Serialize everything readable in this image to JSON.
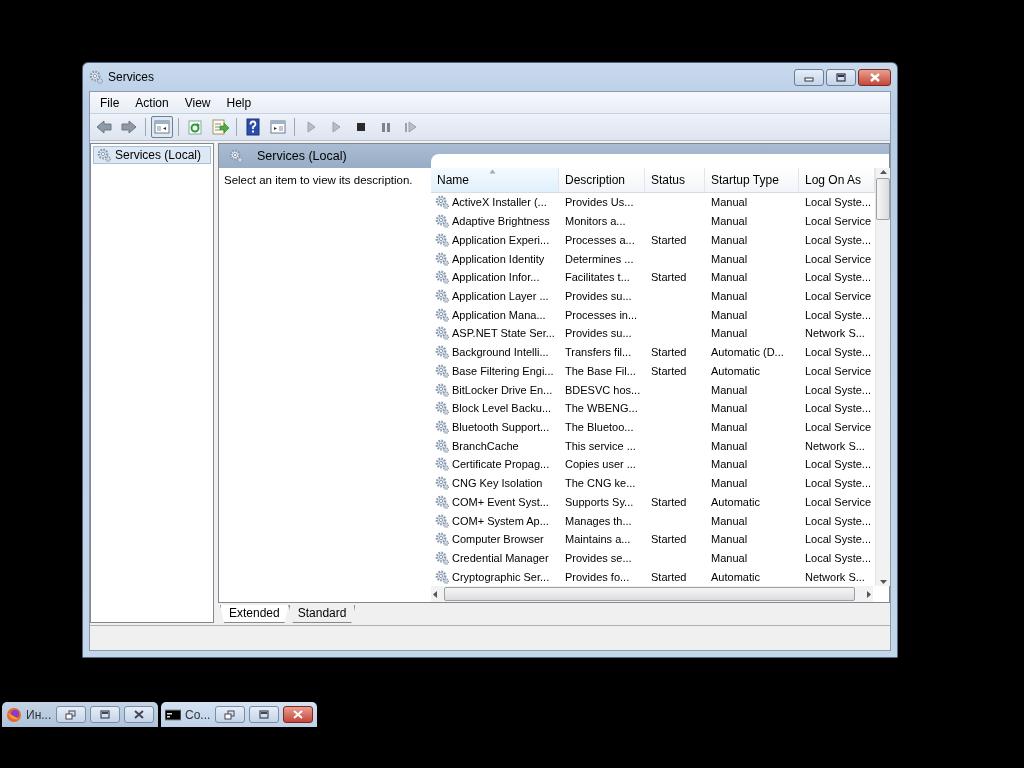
{
  "window": {
    "title": "Services"
  },
  "menu": [
    "File",
    "Action",
    "View",
    "Help"
  ],
  "toolbar": [
    {
      "kind": "back",
      "pressed": false
    },
    {
      "kind": "forward",
      "pressed": false
    },
    {
      "kind": "sep"
    },
    {
      "kind": "tree",
      "pressed": true
    },
    {
      "kind": "sep"
    },
    {
      "kind": "refresh",
      "pressed": false
    },
    {
      "kind": "export",
      "pressed": false
    },
    {
      "kind": "sep"
    },
    {
      "kind": "help",
      "pressed": false
    },
    {
      "kind": "panel",
      "pressed": false
    },
    {
      "kind": "sep"
    },
    {
      "kind": "start",
      "pressed": false
    },
    {
      "kind": "start",
      "pressed": false
    },
    {
      "kind": "stop",
      "pressed": false
    },
    {
      "kind": "pause",
      "pressed": false
    },
    {
      "kind": "resume",
      "pressed": false
    }
  ],
  "tree": [
    {
      "label": "Services (Local)",
      "selected": true
    }
  ],
  "pane": {
    "title": "Services (Local)",
    "description": "Select an item to view its description."
  },
  "table": {
    "columns": [
      {
        "label": "Name",
        "sorted": true
      },
      {
        "label": "Description",
        "sorted": false
      },
      {
        "label": "Status",
        "sorted": false
      },
      {
        "label": "Startup Type",
        "sorted": false
      },
      {
        "label": "Log On As",
        "sorted": false
      }
    ],
    "rows": [
      {
        "name": "ActiveX Installer (...",
        "description": "Provides Us...",
        "startup_type": "Manual",
        "log_on_as": "Local Syste..."
      },
      {
        "name": "Adaptive Brightness",
        "description": "Monitors a...",
        "startup_type": "Manual",
        "log_on_as": "Local Service"
      },
      {
        "name": "Application Experi...",
        "description": "Processes a...",
        "status": "Started",
        "startup_type": "Manual",
        "log_on_as": "Local Syste..."
      },
      {
        "name": "Application Identity",
        "description": "Determines ...",
        "startup_type": "Manual",
        "log_on_as": "Local Service"
      },
      {
        "name": "Application Infor...",
        "description": "Facilitates t...",
        "status": "Started",
        "startup_type": "Manual",
        "log_on_as": "Local Syste..."
      },
      {
        "name": "Application Layer ...",
        "description": "Provides su...",
        "startup_type": "Manual",
        "log_on_as": "Local Service"
      },
      {
        "name": "Application Mana...",
        "description": "Processes in...",
        "startup_type": "Manual",
        "log_on_as": "Local Syste..."
      },
      {
        "name": "ASP.NET State Ser...",
        "description": "Provides su...",
        "startup_type": "Manual",
        "log_on_as": "Network S..."
      },
      {
        "name": "Background Intelli...",
        "description": "Transfers fil...",
        "status": "Started",
        "startup_type": "Automatic (D...",
        "log_on_as": "Local Syste..."
      },
      {
        "name": "Base Filtering Engi...",
        "description": "The Base Fil...",
        "status": "Started",
        "startup_type": "Automatic",
        "log_on_as": "Local Service"
      },
      {
        "name": "BitLocker Drive En...",
        "description": "BDESVC hos...",
        "startup_type": "Manual",
        "log_on_as": "Local Syste..."
      },
      {
        "name": "Block Level Backu...",
        "description": "The WBENG...",
        "startup_type": "Manual",
        "log_on_as": "Local Syste..."
      },
      {
        "name": "Bluetooth Support...",
        "description": "The Bluetoo...",
        "startup_type": "Manual",
        "log_on_as": "Local Service"
      },
      {
        "name": "BranchCache",
        "description": "This service ...",
        "startup_type": "Manual",
        "log_on_as": "Network S..."
      },
      {
        "name": "Certificate Propag...",
        "description": "Copies user ...",
        "startup_type": "Manual",
        "log_on_as": "Local Syste..."
      },
      {
        "name": "CNG Key Isolation",
        "description": "The CNG ke...",
        "startup_type": "Manual",
        "log_on_as": "Local Syste..."
      },
      {
        "name": "COM+ Event Syst...",
        "description": "Supports Sy...",
        "status": "Started",
        "startup_type": "Automatic",
        "log_on_as": "Local Service"
      },
      {
        "name": "COM+ System Ap...",
        "description": "Manages th...",
        "startup_type": "Manual",
        "log_on_as": "Local Syste..."
      },
      {
        "name": "Computer Browser",
        "description": "Maintains a...",
        "status": "Started",
        "startup_type": "Manual",
        "log_on_as": "Local Syste..."
      },
      {
        "name": "Credential Manager",
        "description": "Provides se...",
        "startup_type": "Manual",
        "log_on_as": "Local Syste..."
      },
      {
        "name": "Cryptographic Ser...",
        "description": "Provides fo...",
        "status": "Started",
        "startup_type": "Automatic",
        "log_on_as": "Network S..."
      }
    ]
  },
  "view_tabs": [
    {
      "label": "Extended",
      "selected": true
    },
    {
      "label": "Standard",
      "selected": false
    }
  ],
  "taskbar": [
    {
      "kind": "browser",
      "label": "Ин...",
      "selected": false
    },
    {
      "kind": "console",
      "label": "Co...",
      "selected": true
    }
  ]
}
